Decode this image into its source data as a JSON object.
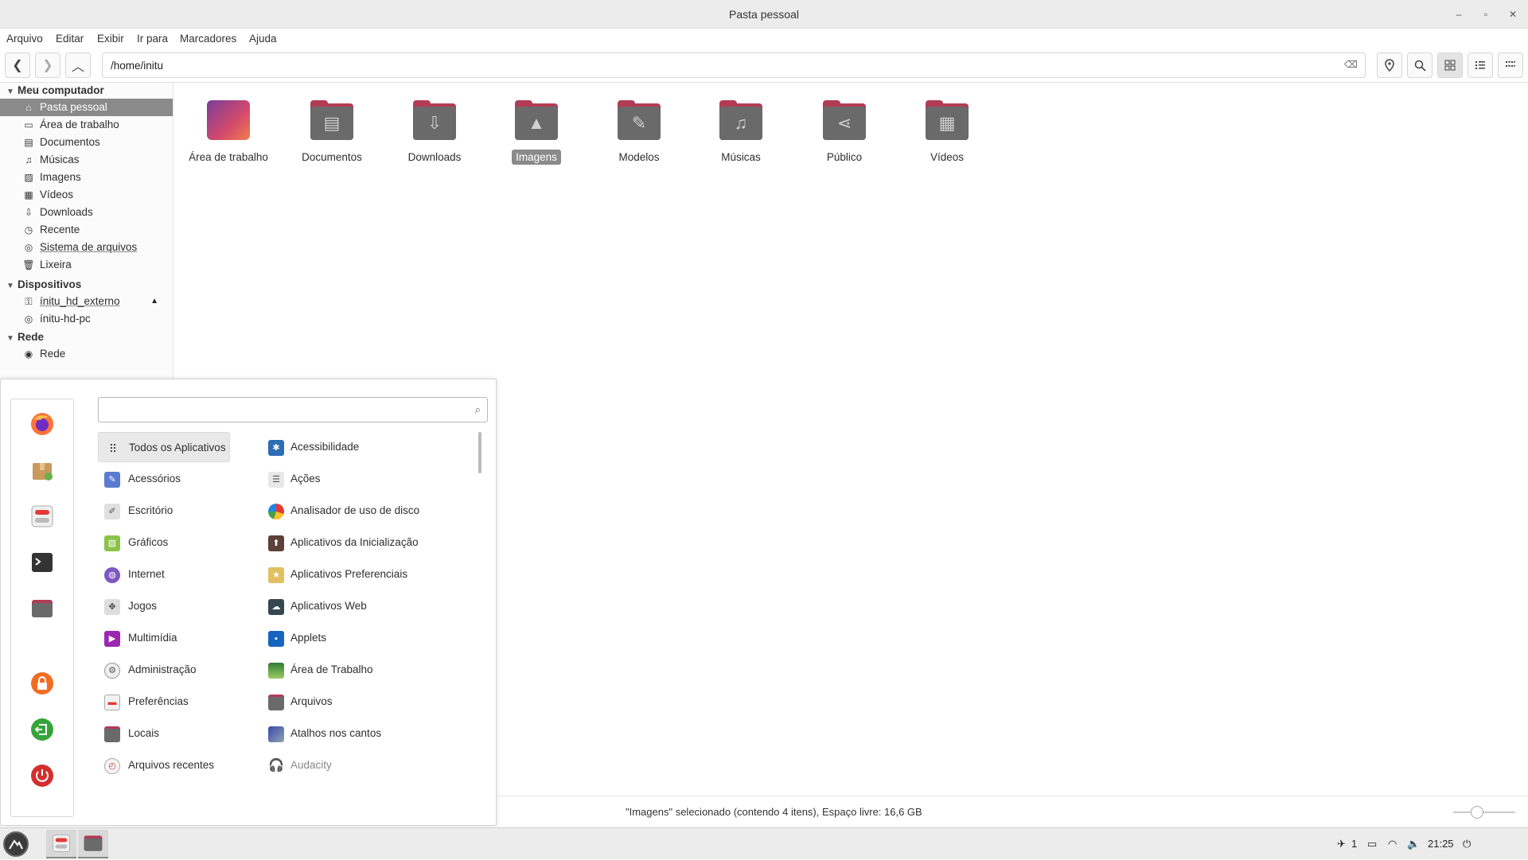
{
  "window": {
    "title": "Pasta pessoal"
  },
  "menubar": [
    "Arquivo",
    "Editar",
    "Exibir",
    "Ir para",
    "Marcadores",
    "Ajuda"
  ],
  "toolbar": {
    "path": "/home/initu",
    "icons": [
      "back-icon",
      "forward-icon",
      "up-icon",
      "location-icon",
      "search-icon",
      "icon-view-icon",
      "list-view-icon",
      "compact-view-icon"
    ]
  },
  "sidebar": {
    "sections": {
      "computer": "Meu computador",
      "devices": "Dispositivos",
      "network": "Rede"
    },
    "computer_items": [
      "Pasta pessoal",
      "Área de trabalho",
      "Documentos",
      "Músicas",
      "Imagens",
      "Vídeos",
      "Downloads",
      "Recente",
      "Sistema de arquivos",
      "Lixeira"
    ],
    "device_items": [
      "ínitu_hd_externo",
      "ínitu-hd-pc"
    ],
    "network_items": [
      "Rede"
    ],
    "selected": "Pasta pessoal"
  },
  "files": [
    "Área de trabalho",
    "Documentos",
    "Downloads",
    "Imagens",
    "Modelos",
    "Músicas",
    "Público",
    "Vídeos"
  ],
  "selected_file": "Imagens",
  "status": {
    "text": "\"Imagens\" selecionado (contendo 4 itens), Espaço livre: 16,6 GB"
  },
  "app_menu": {
    "search_placeholder": "",
    "categories": [
      "Todos os Aplicativos",
      "Acessórios",
      "Escritório",
      "Gráficos",
      "Internet",
      "Jogos",
      "Multimídia",
      "Administração",
      "Preferências",
      "Locais",
      "Arquivos recentes"
    ],
    "apps": [
      "Acessibilidade",
      "Ações",
      "Analisador de uso de disco",
      "Aplicativos da Inicialização",
      "Aplicativos Preferenciais",
      "Aplicativos Web",
      "Applets",
      "Área de Trabalho",
      "Arquivos",
      "Atalhos nos cantos",
      "Audacity"
    ],
    "selected_category": "Todos os Aplicativos"
  },
  "panel": {
    "workspace": "1",
    "clock": "21:25"
  },
  "colors": {
    "folder_tab": "#b23c55",
    "folder_body": "#6a6a6a",
    "selection": "#8a8a8a"
  }
}
